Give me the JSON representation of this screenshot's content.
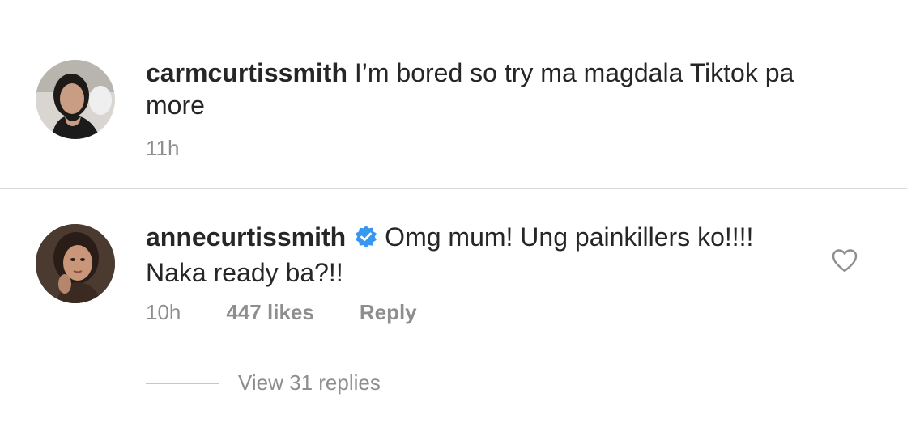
{
  "comments": [
    {
      "username": "carmcurtissmith",
      "text": "I’m bored so try ma magdala Tiktok pa more",
      "time": "11h"
    },
    {
      "username": "annecurtissmith",
      "verified": true,
      "text": "Omg mum! Ung painkillers ko!!!! Naka ready ba?!!",
      "time": "10h",
      "likes": "447 likes",
      "reply_label": "Reply"
    }
  ],
  "view_replies": "View 31 replies",
  "icons": {
    "verified": "verified-badge-icon",
    "heart": "heart-outline-icon"
  },
  "colors": {
    "verified_blue": "#3897f0",
    "text": "#262626",
    "muted": "#8e8e8e"
  }
}
